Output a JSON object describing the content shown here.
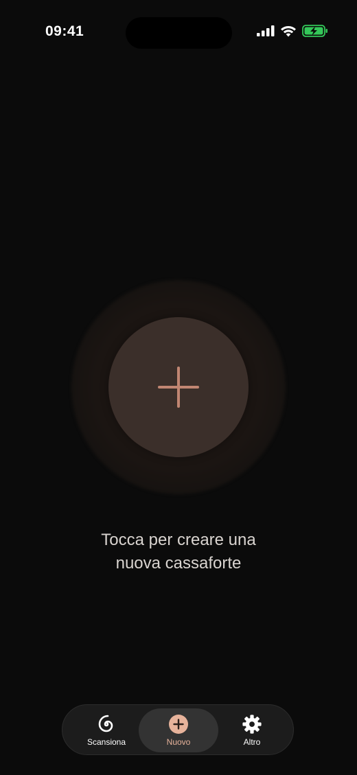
{
  "status_bar": {
    "time": "09:41"
  },
  "main": {
    "hint_line1": "Tocca per creare una",
    "hint_line2": "nuova cassaforte"
  },
  "tab_bar": {
    "tabs": [
      {
        "label": "Scansiona",
        "icon": "spiral-icon",
        "active": false
      },
      {
        "label": "Nuovo",
        "icon": "plus-circle-icon",
        "active": true
      },
      {
        "label": "Altro",
        "icon": "gear-icon",
        "active": false
      }
    ]
  },
  "colors": {
    "background": "#0b0b0b",
    "accent": "#e7b39b",
    "battery": "#34c759"
  }
}
